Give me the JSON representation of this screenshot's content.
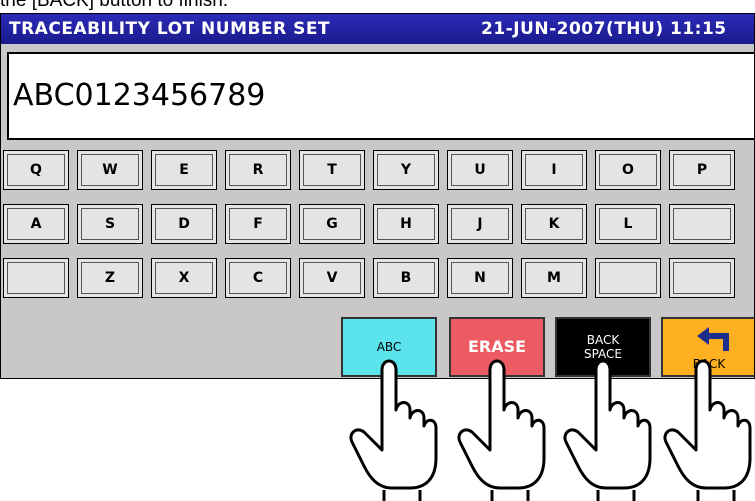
{
  "instruction": "the [BACK] button to finish.",
  "title": "TRACEABILITY LOT NUMBER SET",
  "datetime": "21-JUN-2007(THU) 11:15",
  "entry_value": "ABC0123456789",
  "keyboard": {
    "row1": [
      "Q",
      "W",
      "E",
      "R",
      "T",
      "Y",
      "U",
      "I",
      "O",
      "P"
    ],
    "row2": [
      "A",
      "S",
      "D",
      "F",
      "G",
      "H",
      "J",
      "K",
      "L",
      ""
    ],
    "row3": [
      "",
      "Z",
      "X",
      "C",
      "V",
      "B",
      "N",
      "M",
      "",
      ""
    ]
  },
  "buttons": {
    "abc": "ABC",
    "erase": "ERASE",
    "backspace_line1": "BACK",
    "backspace_line2": "SPACE",
    "back": "BACK"
  },
  "colors": {
    "titlebar": "#1a1a8c",
    "abc": "#5ce4ec",
    "erase": "#ec5a62",
    "backspace": "#000000",
    "back": "#ffb020"
  },
  "icons": [
    "back-arrow-icon",
    "pointing-hand-icon"
  ]
}
